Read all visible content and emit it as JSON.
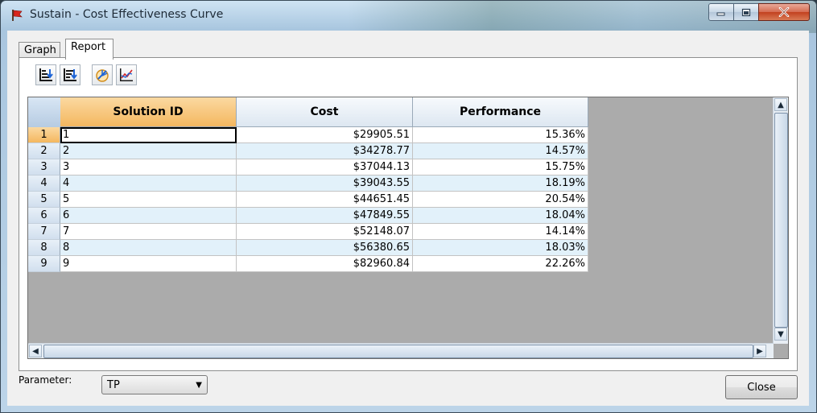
{
  "window": {
    "title": "Sustain - Cost Effectiveness Curve"
  },
  "tabs": [
    {
      "label": "Graph",
      "active": false
    },
    {
      "label": "Report",
      "active": true
    }
  ],
  "toolbar": {
    "icons": [
      "sort-ascending-icon",
      "sort-descending-icon",
      "pie-chart-icon",
      "line-chart-icon"
    ]
  },
  "table": {
    "columns": [
      "Solution ID",
      "Cost",
      "Performance"
    ],
    "rows": [
      {
        "num": "1",
        "solution_id": "1",
        "cost": "$29905.51",
        "performance": "15.36%"
      },
      {
        "num": "2",
        "solution_id": "2",
        "cost": "$34278.77",
        "performance": "14.57%"
      },
      {
        "num": "3",
        "solution_id": "3",
        "cost": "$37044.13",
        "performance": "15.75%"
      },
      {
        "num": "4",
        "solution_id": "4",
        "cost": "$39043.55",
        "performance": "18.19%"
      },
      {
        "num": "5",
        "solution_id": "5",
        "cost": "$44651.45",
        "performance": "20.54%"
      },
      {
        "num": "6",
        "solution_id": "6",
        "cost": "$47849.55",
        "performance": "18.04%"
      },
      {
        "num": "7",
        "solution_id": "7",
        "cost": "$52148.07",
        "performance": "14.14%"
      },
      {
        "num": "8",
        "solution_id": "8",
        "cost": "$56380.65",
        "performance": "18.03%"
      },
      {
        "num": "9",
        "solution_id": "9",
        "cost": "$82960.84",
        "performance": "22.26%"
      }
    ]
  },
  "footer": {
    "parameter_label": "Parameter:",
    "parameter_value": "TP",
    "close_label": "Close"
  }
}
